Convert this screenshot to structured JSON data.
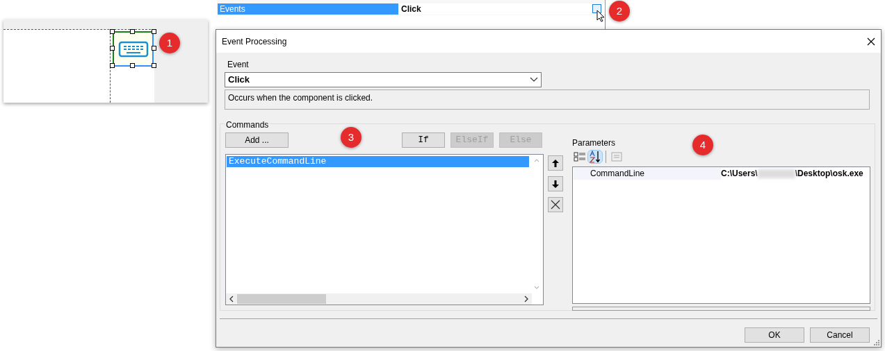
{
  "property_grid": {
    "rows": [
      {
        "name": "Events",
        "value": "Click",
        "selected": true
      }
    ]
  },
  "badges": [
    "1",
    "2",
    "3",
    "4"
  ],
  "dialog": {
    "title": "Event Processing",
    "event_label": "Event",
    "event_value": "Click",
    "description": "Occurs when the component is clicked.",
    "commands_label": "Commands",
    "add_button": "Add ...",
    "branch_buttons": [
      {
        "label": "If",
        "disabled": false
      },
      {
        "label": "ElseIf",
        "disabled": true
      },
      {
        "label": "Else",
        "disabled": true
      }
    ],
    "commands": [
      {
        "name": "ExecuteCommandLine",
        "selected": true
      }
    ],
    "parameters_label": "Parameters",
    "toolbar": [
      {
        "kind": "categorized",
        "selected": false
      },
      {
        "kind": "alphabetical",
        "selected": true
      },
      {
        "kind": "pages",
        "selected": false
      }
    ],
    "parameters": [
      {
        "name": "CommandLine",
        "value_before": "C:\\Users\\",
        "value_after": "\\Desktop\\osk.exe"
      }
    ],
    "buttons": [
      "OK",
      "Cancel"
    ]
  }
}
